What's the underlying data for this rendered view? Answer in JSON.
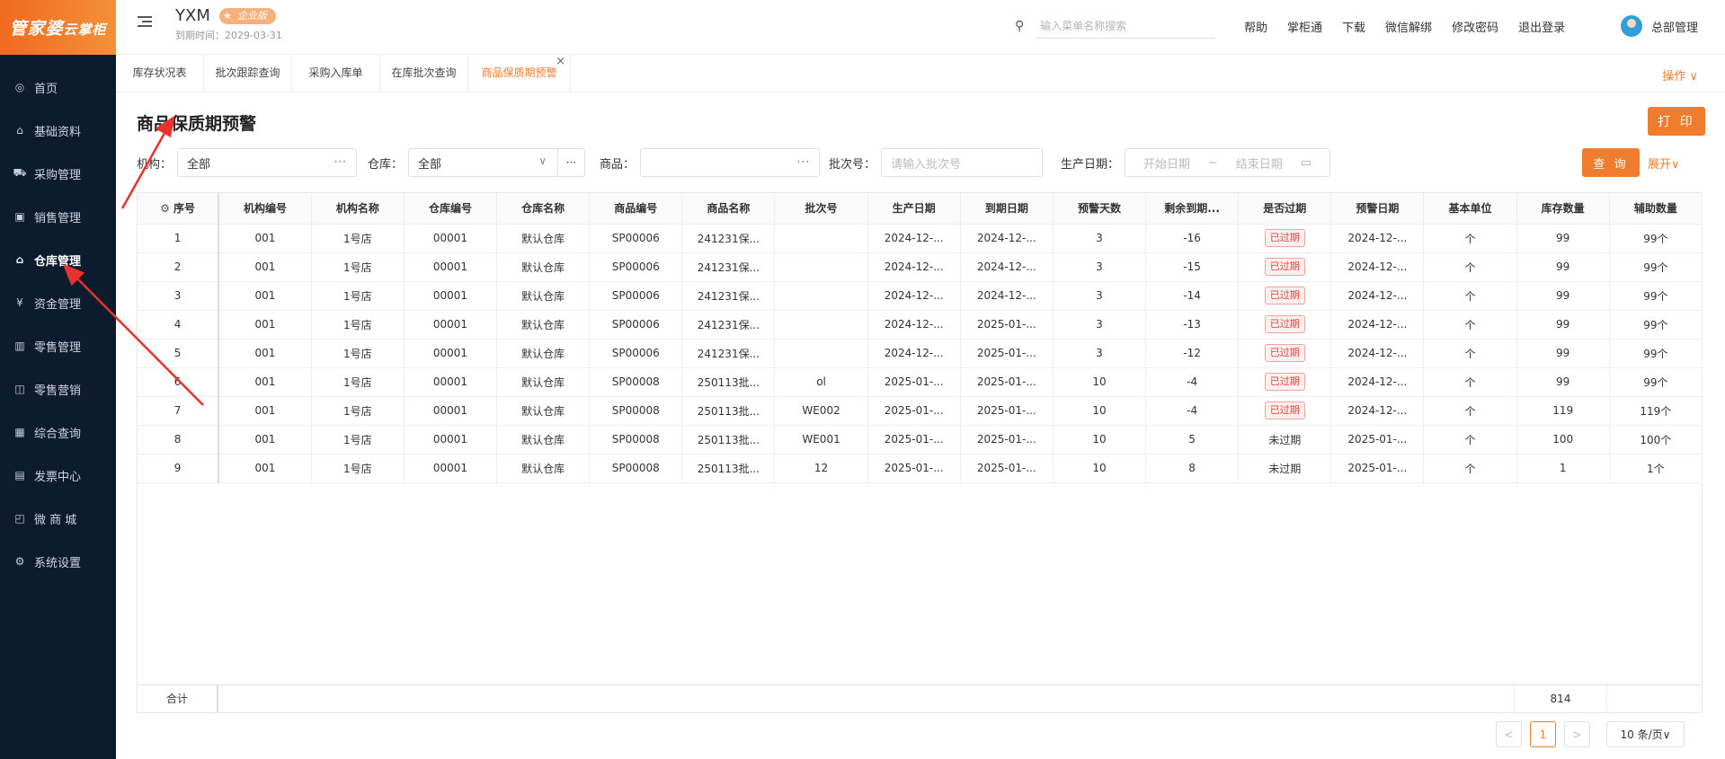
{
  "logo": {
    "main": "管家婆",
    "sub": "云掌柜"
  },
  "sidebar": {
    "items": [
      {
        "label": "首页",
        "icon": "globe-icon",
        "glyph": "◎"
      },
      {
        "label": "基础资料",
        "icon": "home-icon",
        "glyph": "⌂"
      },
      {
        "label": "采购管理",
        "icon": "cart-icon",
        "glyph": "⛟"
      },
      {
        "label": "销售管理",
        "icon": "sales-icon",
        "glyph": "▣"
      },
      {
        "label": "仓库管理",
        "icon": "warehouse-icon",
        "glyph": "⌂"
      },
      {
        "label": "资金管理",
        "icon": "money-icon",
        "glyph": "¥"
      },
      {
        "label": "零售管理",
        "icon": "bar-chart-icon",
        "glyph": "▥"
      },
      {
        "label": "零售营销",
        "icon": "gift-icon",
        "glyph": "◫"
      },
      {
        "label": "综合查询",
        "icon": "stats-icon",
        "glyph": "▦"
      },
      {
        "label": "发票中心",
        "icon": "invoice-icon",
        "glyph": "▤"
      },
      {
        "label": "微 商 城",
        "icon": "shop-icon",
        "glyph": "◰"
      },
      {
        "label": "系统设置",
        "icon": "gear-icon",
        "glyph": "⚙"
      }
    ]
  },
  "header": {
    "brand": "YXM",
    "edition": "企业版",
    "expire": "到期时间：2029-03-31",
    "search_placeholder": "输入菜单名称搜索",
    "links": [
      "帮助",
      "掌柜通",
      "下载",
      "微信解绑",
      "修改密码",
      "退出登录"
    ],
    "user": "总部管理"
  },
  "tabs": [
    "库存状况表",
    "批次跟踪查询",
    "采购入库单",
    "在库批次查询",
    "商品保质期预警"
  ],
  "ops_label": "操作 ∨",
  "page": {
    "title": "商品保质期预警",
    "print": "打 印",
    "query": "查 询",
    "expand": "展开∨",
    "filters": {
      "org_label": "机构：",
      "org_value": "全部",
      "wh_label": "仓库：",
      "wh_value": "全部",
      "goods_label": "商品：",
      "batch_label": "批次号：",
      "batch_placeholder": "请输入批次号",
      "date_label": "生产日期：",
      "start_placeholder": "开始日期",
      "end_placeholder": "结束日期",
      "range_sep": "~"
    }
  },
  "table": {
    "columns": [
      "序号",
      "机构编号",
      "机构名称",
      "仓库编号",
      "仓库名称",
      "商品编号",
      "商品名称",
      "批次号",
      "生产日期",
      "到期日期",
      "预警天数",
      "剩余到期...",
      "是否过期",
      "预警日期",
      "基本单位",
      "库存数量",
      "辅助数量"
    ],
    "rows": [
      [
        "1",
        "001",
        "1号店",
        "00001",
        "默认仓库",
        "SP00006",
        "241231保...",
        "",
        "2024-12-...",
        "2024-12-...",
        "3",
        "-16",
        "已过期",
        "2024-12-...",
        "个",
        "99",
        "99个"
      ],
      [
        "2",
        "001",
        "1号店",
        "00001",
        "默认仓库",
        "SP00006",
        "241231保...",
        "",
        "2024-12-...",
        "2024-12-...",
        "3",
        "-15",
        "已过期",
        "2024-12-...",
        "个",
        "99",
        "99个"
      ],
      [
        "3",
        "001",
        "1号店",
        "00001",
        "默认仓库",
        "SP00006",
        "241231保...",
        "",
        "2024-12-...",
        "2024-12-...",
        "3",
        "-14",
        "已过期",
        "2024-12-...",
        "个",
        "99",
        "99个"
      ],
      [
        "4",
        "001",
        "1号店",
        "00001",
        "默认仓库",
        "SP00006",
        "241231保...",
        "",
        "2024-12-...",
        "2025-01-...",
        "3",
        "-13",
        "已过期",
        "2024-12-...",
        "个",
        "99",
        "99个"
      ],
      [
        "5",
        "001",
        "1号店",
        "00001",
        "默认仓库",
        "SP00006",
        "241231保...",
        "",
        "2024-12-...",
        "2025-01-...",
        "3",
        "-12",
        "已过期",
        "2024-12-...",
        "个",
        "99",
        "99个"
      ],
      [
        "6",
        "001",
        "1号店",
        "00001",
        "默认仓库",
        "SP00008",
        "250113批...",
        "ol",
        "2025-01-...",
        "2025-01-...",
        "10",
        "-4",
        "已过期",
        "2024-12-...",
        "个",
        "99",
        "99个"
      ],
      [
        "7",
        "001",
        "1号店",
        "00001",
        "默认仓库",
        "SP00008",
        "250113批...",
        "WE002",
        "2025-01-...",
        "2025-01-...",
        "10",
        "-4",
        "已过期",
        "2024-12-...",
        "个",
        "119",
        "119个"
      ],
      [
        "8",
        "001",
        "1号店",
        "00001",
        "默认仓库",
        "SP00008",
        "250113批...",
        "WE001",
        "2025-01-...",
        "2025-01-...",
        "10",
        "5",
        "未过期",
        "2025-01-...",
        "个",
        "100",
        "100个"
      ],
      [
        "9",
        "001",
        "1号店",
        "00001",
        "默认仓库",
        "SP00008",
        "250113批...",
        "12",
        "2025-01-...",
        "2025-01-...",
        "10",
        "8",
        "未过期",
        "2025-01-...",
        "个",
        "1",
        "1个"
      ]
    ],
    "footer_label": "合计",
    "footer_total": "814"
  },
  "pagination": {
    "prev": "<",
    "page": "1",
    "next": ">",
    "size": "10 条/页∨"
  },
  "colors": {
    "accent": "#f07c2e",
    "sidebar": "#0d1b2e",
    "expired": "#e0443d",
    "arrow": "#e8322b"
  }
}
